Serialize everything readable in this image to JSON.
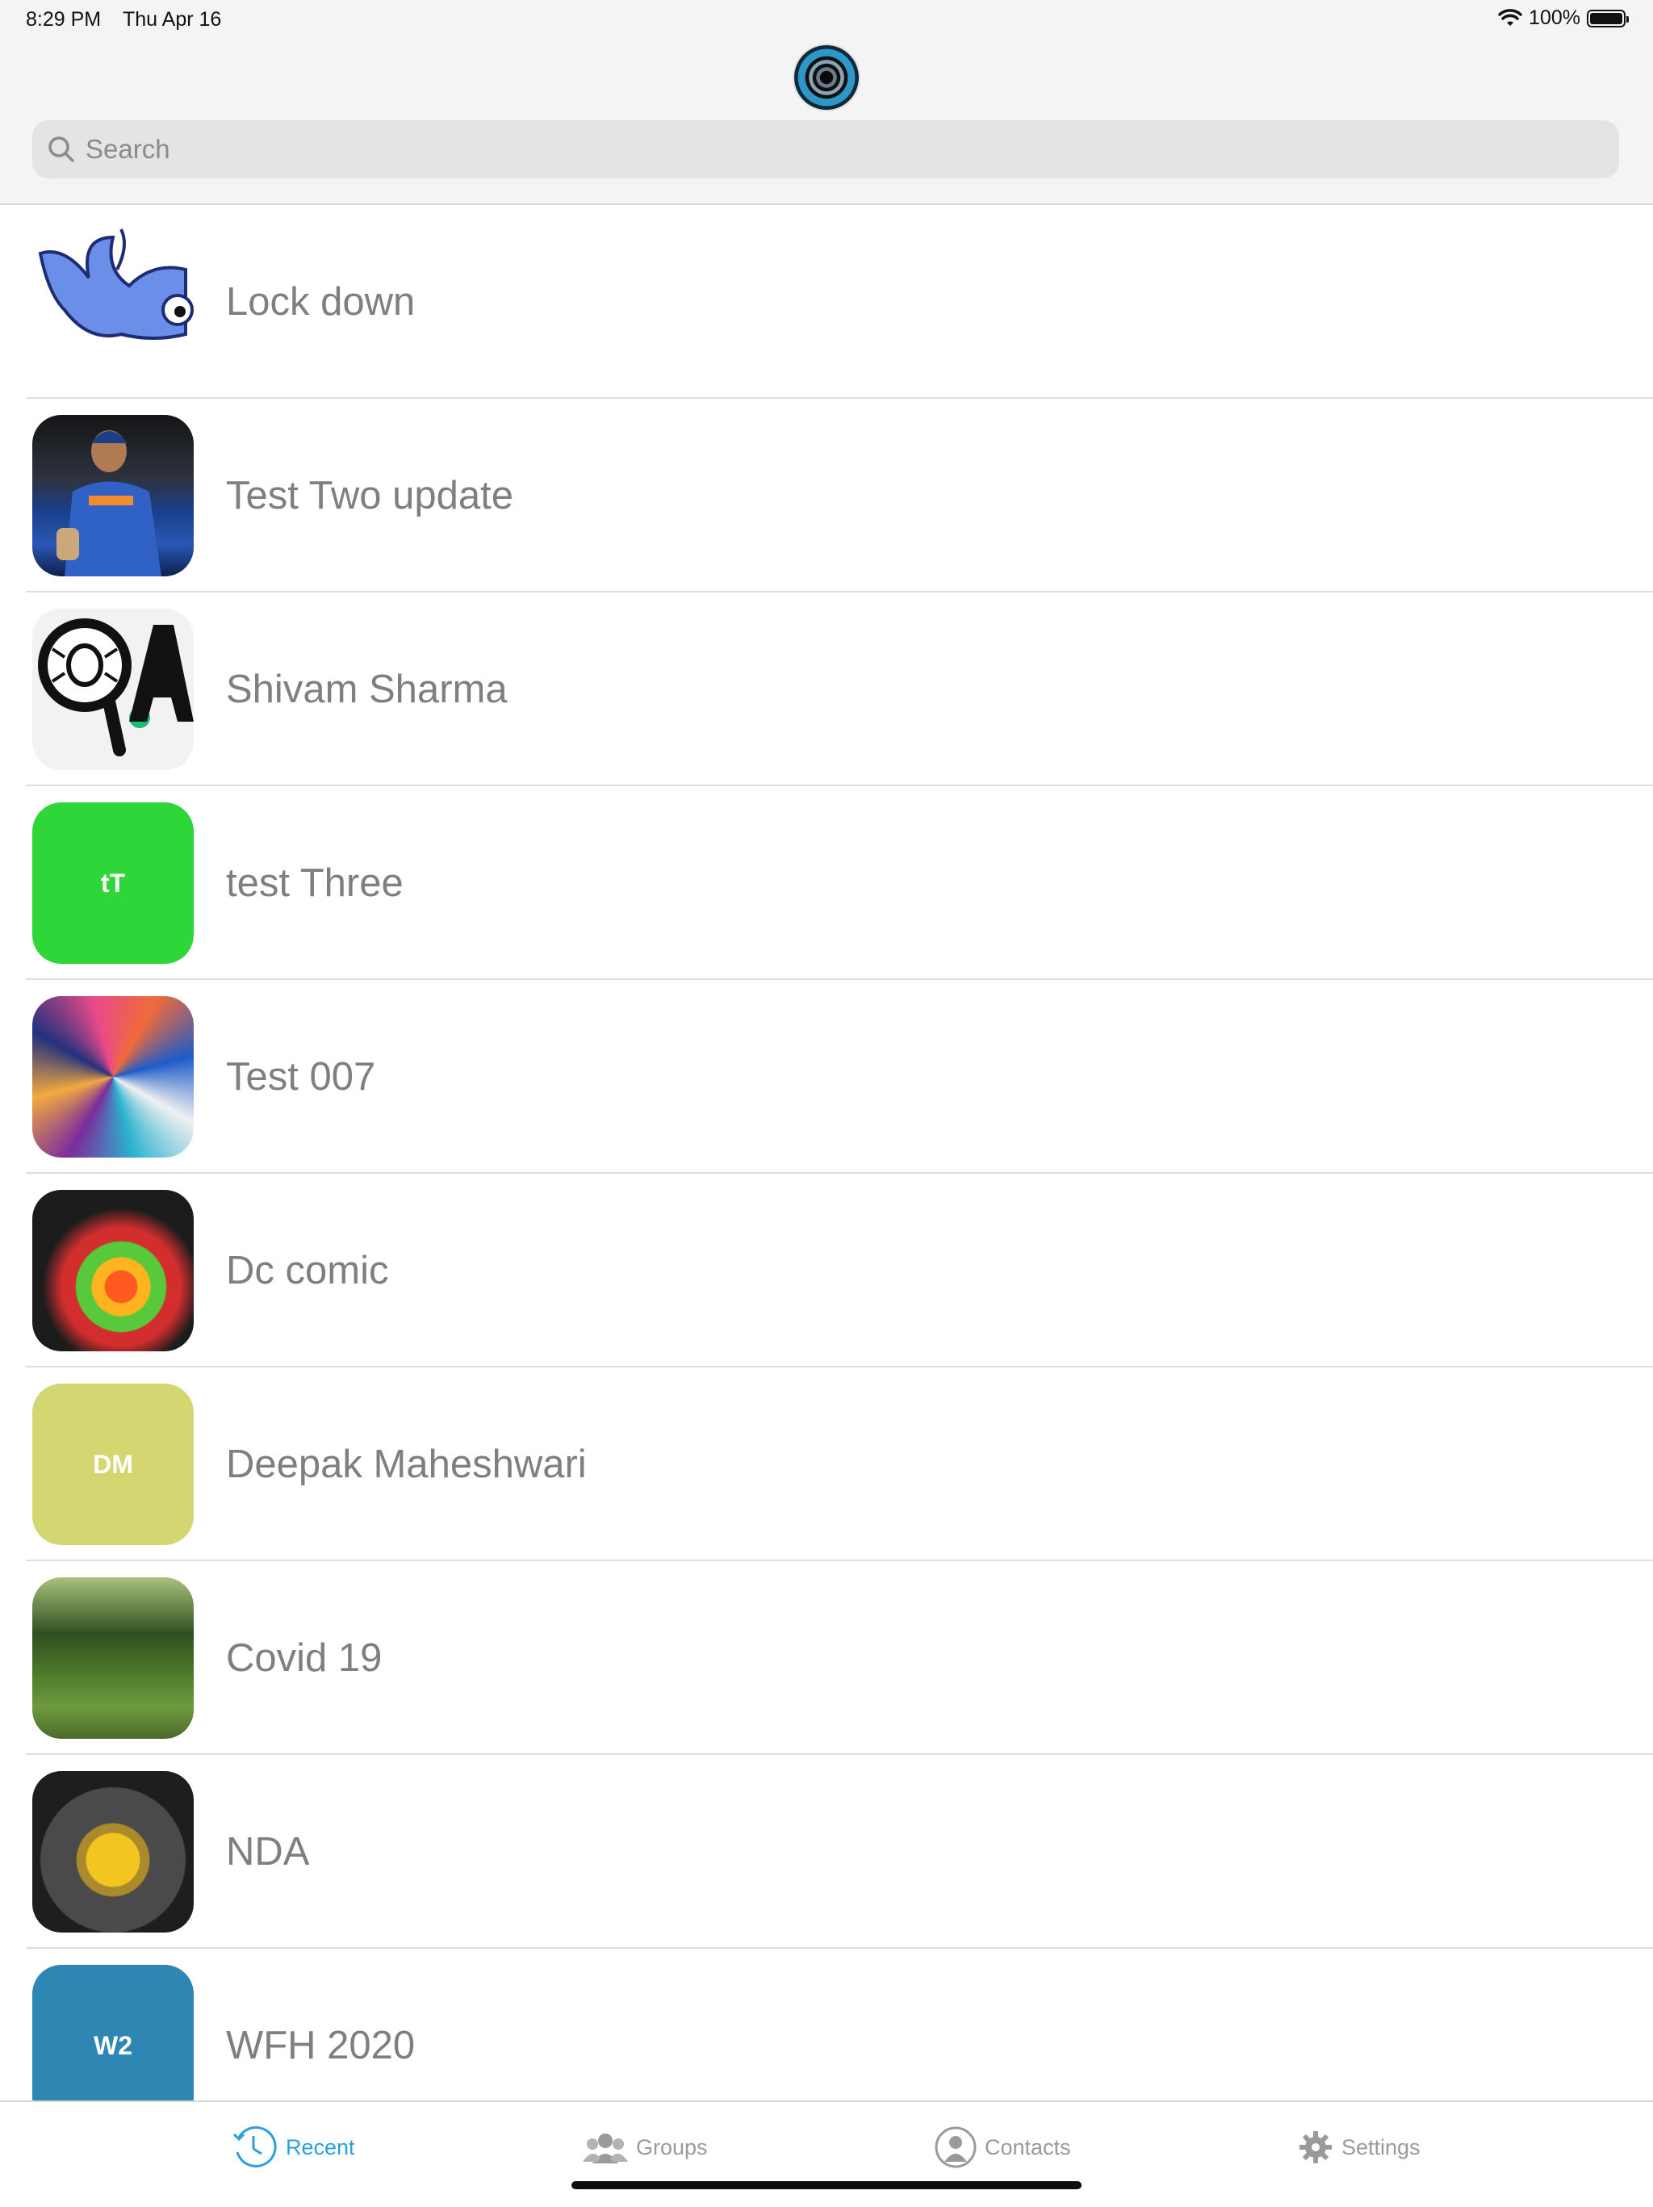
{
  "status_bar": {
    "time": "8:29 PM",
    "date": "Thu Apr 16",
    "battery": "100%"
  },
  "search": {
    "placeholder": "Search",
    "value": ""
  },
  "rows": [
    {
      "title": "Lock down",
      "avatar_type": "image",
      "avatar_image": "blue-bird"
    },
    {
      "title": "Test Two update",
      "avatar_type": "image",
      "avatar_image": "cricketer"
    },
    {
      "title": "Shivam Sharma",
      "avatar_type": "image",
      "avatar_image": "qa-logo"
    },
    {
      "title": "test Three",
      "avatar_type": "initials",
      "initials": "tT",
      "color": "#2ed63a"
    },
    {
      "title": "Test 007",
      "avatar_type": "image",
      "avatar_image": "abstract-paint"
    },
    {
      "title": "Dc comic",
      "avatar_type": "image",
      "avatar_image": "color-powder"
    },
    {
      "title": "Deepak Maheshwari",
      "avatar_type": "initials",
      "initials": "DM",
      "color": "#d4d671"
    },
    {
      "title": "Covid 19",
      "avatar_type": "image",
      "avatar_image": "forest"
    },
    {
      "title": "NDA",
      "avatar_type": "image",
      "avatar_image": "yellow-toy"
    },
    {
      "title": "WFH 2020",
      "avatar_type": "initials",
      "initials": "W2",
      "color": "#2d87b2"
    }
  ],
  "tab_bar": {
    "tabs": [
      {
        "label": "Recent",
        "icon": "clock-arrow-icon",
        "active": true
      },
      {
        "label": "Groups",
        "icon": "group-icon",
        "active": false
      },
      {
        "label": "Contacts",
        "icon": "contact-icon",
        "active": false
      },
      {
        "label": "Settings",
        "icon": "gear-icon",
        "active": false
      }
    ]
  },
  "colors": {
    "accent": "#2aa1dc",
    "inactive_tab": "#9a9a9a",
    "row_text": "#7f7f7f"
  }
}
